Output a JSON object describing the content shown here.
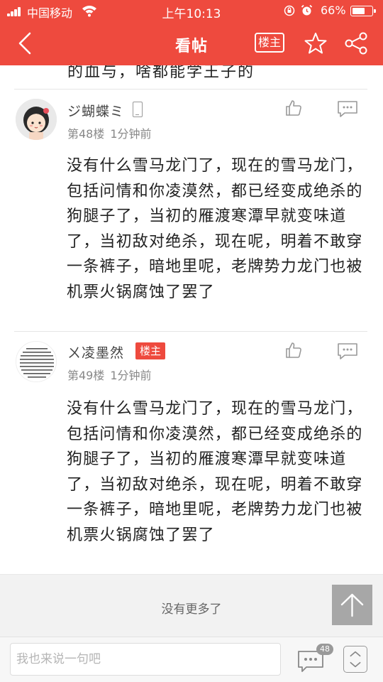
{
  "status_bar": {
    "carrier": "中国移动",
    "time": "上午10:13",
    "battery_percent": "66%",
    "battery_level": 0.66
  },
  "navbar": {
    "title": "看帖",
    "op_label": "楼主"
  },
  "previous_post_tail": "的血与，啥都能学王子的",
  "posts": [
    {
      "username": "ジ蝴蝶ミ",
      "floor": "第48楼",
      "time": "1分钟前",
      "body": "没有什么雪马龙门了，现在的雪马龙门，包括问情和你凌漠然，都已经变成绝杀的狗腿子了，当初的雁渡寒潭早就变味道了，当初敌对绝杀，现在呢，明着不敢穿一条裤子，暗地里呢，老牌势力龙门也被机票火锅腐蚀了罢了"
    },
    {
      "username": "ㄨ凌墨然",
      "op_badge": "楼主",
      "floor": "第49楼",
      "time": "1分钟前",
      "body": "没有什么雪马龙门了，现在的雪马龙门，包括问情和你凌漠然，都已经变成绝杀的狗腿子了，当初的雁渡寒潭早就变味道了，当初敌对绝杀，现在呢，明着不敢穿一条裤子，暗地里呢，老牌势力龙门也被机票火锅腐蚀了罢了"
    }
  ],
  "footer": {
    "no_more": "没有更多了"
  },
  "bottom_bar": {
    "input_placeholder": "我也来说一句吧",
    "comment_count": "48"
  },
  "colors": {
    "accent": "#ee4a3e",
    "background": "#ffffff",
    "footer_bg": "#f2f2f2"
  }
}
